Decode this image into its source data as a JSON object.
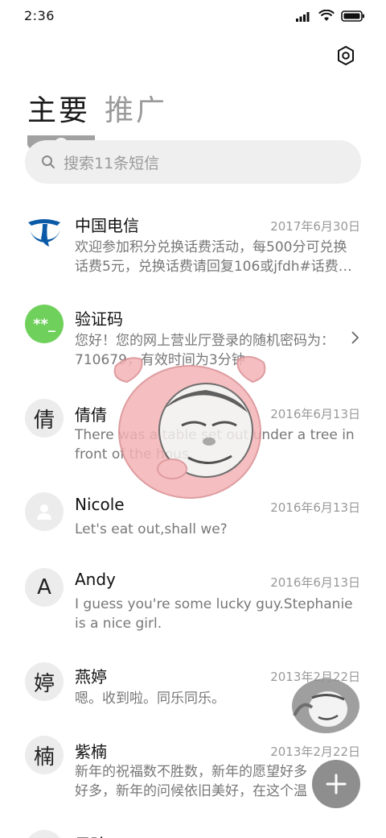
{
  "status_bar": {
    "time": "2:36"
  },
  "tabs": [
    {
      "label": "主要",
      "active": true
    },
    {
      "label": "推广",
      "active": false
    }
  ],
  "search": {
    "placeholder": "搜索11条短信"
  },
  "messages": [
    {
      "name": "中国电信",
      "date": "2017年6月30日",
      "preview": "欢迎参加积分兑换话费活动，每500分可兑换话费5元，兑换话费请回复106或jfdh#话费…",
      "avatar_text": "",
      "avatar_type": "telecom-logo"
    },
    {
      "name": "验证码",
      "date": "",
      "preview": "您好！您的网上营业厅登录的随机密码为：710679，有效时间为3分钟",
      "avatar_text": "**_",
      "avatar_type": "verification",
      "avatar_color": "#6fd15c"
    },
    {
      "name": "倩倩",
      "date": "2016年6月13日",
      "preview": "There was a table set out under a tree in front of the hous",
      "avatar_text": "倩",
      "avatar_type": "letter"
    },
    {
      "name": "Nicole",
      "date": "2016年6月13日",
      "preview": "Let's eat out,shall we?",
      "avatar_text": "",
      "avatar_type": "person"
    },
    {
      "name": "Andy",
      "date": "2016年6月13日",
      "preview": "I guess you're some lucky guy.Stephanie is a nice girl.",
      "avatar_text": "A",
      "avatar_type": "letter"
    },
    {
      "name": "燕婷",
      "date": "2013年2月22日",
      "preview": "嗯。收到啦。同乐同乐。",
      "avatar_text": "婷",
      "avatar_type": "letter"
    },
    {
      "name": "紫楠",
      "date": "2013年2月22日",
      "preview": "新年的祝福数不胜数，新年的愿望好多好多，新年的问候依旧美好，在这个温馨的时刻",
      "avatar_text": "楠",
      "avatar_type": "letter"
    },
    {
      "name": "子玲",
      "date": "",
      "preview": "",
      "avatar_text": "",
      "avatar_type": "letter"
    }
  ],
  "colors": {
    "accent_telecom": "#0a5aa8",
    "verification_green": "#6fd15c",
    "fab": "#8e8e8e",
    "sticker_pink": "#f4b3b6"
  },
  "icons": {
    "settings": "settings-icon",
    "search": "search-icon",
    "chevron": "chevron-right-icon",
    "compose": "plus-icon"
  }
}
